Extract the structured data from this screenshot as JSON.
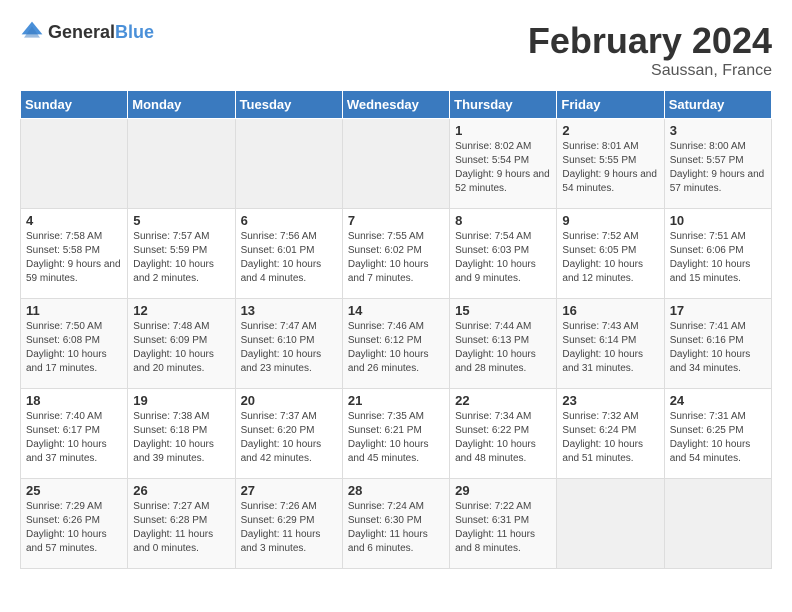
{
  "header": {
    "logo_general": "General",
    "logo_blue": "Blue",
    "title": "February 2024",
    "subtitle": "Saussan, France"
  },
  "days_of_week": [
    "Sunday",
    "Monday",
    "Tuesday",
    "Wednesday",
    "Thursday",
    "Friday",
    "Saturday"
  ],
  "weeks": [
    [
      {
        "day": "",
        "info": ""
      },
      {
        "day": "",
        "info": ""
      },
      {
        "day": "",
        "info": ""
      },
      {
        "day": "",
        "info": ""
      },
      {
        "day": "1",
        "info": "Sunrise: 8:02 AM\nSunset: 5:54 PM\nDaylight: 9 hours and 52 minutes."
      },
      {
        "day": "2",
        "info": "Sunrise: 8:01 AM\nSunset: 5:55 PM\nDaylight: 9 hours and 54 minutes."
      },
      {
        "day": "3",
        "info": "Sunrise: 8:00 AM\nSunset: 5:57 PM\nDaylight: 9 hours and 57 minutes."
      }
    ],
    [
      {
        "day": "4",
        "info": "Sunrise: 7:58 AM\nSunset: 5:58 PM\nDaylight: 9 hours and 59 minutes."
      },
      {
        "day": "5",
        "info": "Sunrise: 7:57 AM\nSunset: 5:59 PM\nDaylight: 10 hours and 2 minutes."
      },
      {
        "day": "6",
        "info": "Sunrise: 7:56 AM\nSunset: 6:01 PM\nDaylight: 10 hours and 4 minutes."
      },
      {
        "day": "7",
        "info": "Sunrise: 7:55 AM\nSunset: 6:02 PM\nDaylight: 10 hours and 7 minutes."
      },
      {
        "day": "8",
        "info": "Sunrise: 7:54 AM\nSunset: 6:03 PM\nDaylight: 10 hours and 9 minutes."
      },
      {
        "day": "9",
        "info": "Sunrise: 7:52 AM\nSunset: 6:05 PM\nDaylight: 10 hours and 12 minutes."
      },
      {
        "day": "10",
        "info": "Sunrise: 7:51 AM\nSunset: 6:06 PM\nDaylight: 10 hours and 15 minutes."
      }
    ],
    [
      {
        "day": "11",
        "info": "Sunrise: 7:50 AM\nSunset: 6:08 PM\nDaylight: 10 hours and 17 minutes."
      },
      {
        "day": "12",
        "info": "Sunrise: 7:48 AM\nSunset: 6:09 PM\nDaylight: 10 hours and 20 minutes."
      },
      {
        "day": "13",
        "info": "Sunrise: 7:47 AM\nSunset: 6:10 PM\nDaylight: 10 hours and 23 minutes."
      },
      {
        "day": "14",
        "info": "Sunrise: 7:46 AM\nSunset: 6:12 PM\nDaylight: 10 hours and 26 minutes."
      },
      {
        "day": "15",
        "info": "Sunrise: 7:44 AM\nSunset: 6:13 PM\nDaylight: 10 hours and 28 minutes."
      },
      {
        "day": "16",
        "info": "Sunrise: 7:43 AM\nSunset: 6:14 PM\nDaylight: 10 hours and 31 minutes."
      },
      {
        "day": "17",
        "info": "Sunrise: 7:41 AM\nSunset: 6:16 PM\nDaylight: 10 hours and 34 minutes."
      }
    ],
    [
      {
        "day": "18",
        "info": "Sunrise: 7:40 AM\nSunset: 6:17 PM\nDaylight: 10 hours and 37 minutes."
      },
      {
        "day": "19",
        "info": "Sunrise: 7:38 AM\nSunset: 6:18 PM\nDaylight: 10 hours and 39 minutes."
      },
      {
        "day": "20",
        "info": "Sunrise: 7:37 AM\nSunset: 6:20 PM\nDaylight: 10 hours and 42 minutes."
      },
      {
        "day": "21",
        "info": "Sunrise: 7:35 AM\nSunset: 6:21 PM\nDaylight: 10 hours and 45 minutes."
      },
      {
        "day": "22",
        "info": "Sunrise: 7:34 AM\nSunset: 6:22 PM\nDaylight: 10 hours and 48 minutes."
      },
      {
        "day": "23",
        "info": "Sunrise: 7:32 AM\nSunset: 6:24 PM\nDaylight: 10 hours and 51 minutes."
      },
      {
        "day": "24",
        "info": "Sunrise: 7:31 AM\nSunset: 6:25 PM\nDaylight: 10 hours and 54 minutes."
      }
    ],
    [
      {
        "day": "25",
        "info": "Sunrise: 7:29 AM\nSunset: 6:26 PM\nDaylight: 10 hours and 57 minutes."
      },
      {
        "day": "26",
        "info": "Sunrise: 7:27 AM\nSunset: 6:28 PM\nDaylight: 11 hours and 0 minutes."
      },
      {
        "day": "27",
        "info": "Sunrise: 7:26 AM\nSunset: 6:29 PM\nDaylight: 11 hours and 3 minutes."
      },
      {
        "day": "28",
        "info": "Sunrise: 7:24 AM\nSunset: 6:30 PM\nDaylight: 11 hours and 6 minutes."
      },
      {
        "day": "29",
        "info": "Sunrise: 7:22 AM\nSunset: 6:31 PM\nDaylight: 11 hours and 8 minutes."
      },
      {
        "day": "",
        "info": ""
      },
      {
        "day": "",
        "info": ""
      }
    ]
  ]
}
